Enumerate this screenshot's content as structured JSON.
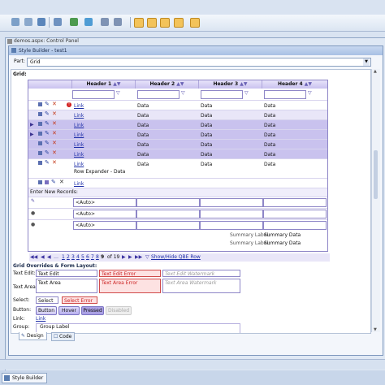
{
  "control_panel": {
    "title": "demos.aspx: Control Panel"
  },
  "style_builder": {
    "title": "Style Builder - test1"
  },
  "part": {
    "label": "Part:",
    "value": "Grid"
  },
  "grid": {
    "section_label": "Grid:",
    "headers": [
      "Header 1",
      "Header 2",
      "Header 3",
      "Header 4"
    ],
    "rows": [
      {
        "link": "Link",
        "c2": "Data",
        "c3": "Data",
        "c4": "Data"
      },
      {
        "link": "Link",
        "c2": "Data",
        "c3": "Data",
        "c4": "Data"
      },
      {
        "link": "Link",
        "c2": "Data",
        "c3": "Data",
        "c4": "Data"
      },
      {
        "link": "Link",
        "c2": "Data",
        "c3": "Data",
        "c4": "Data"
      },
      {
        "link": "Link",
        "c2": "Data",
        "c3": "Data",
        "c4": "Data"
      },
      {
        "link": "Link",
        "c2": "Data",
        "c3": "Data",
        "c4": "Data"
      },
      {
        "link": "Link",
        "c2": "Data",
        "c3": "Data",
        "c4": "Data"
      }
    ],
    "expander": "Row Expander - Data",
    "last_link": "Link",
    "enter_new": "Enter New Records:",
    "auto": "<Auto>",
    "summary_label": "Summary Label:",
    "summary_data": "Summary Data",
    "pager_pages": [
      "1",
      "2",
      "3",
      "4",
      "5",
      "6",
      "7",
      "8",
      "9"
    ],
    "pager_info": "of 19",
    "pager_current": "9",
    "show_hide": "Show/Hide QBE Row"
  },
  "overrides": {
    "title": "Grid Overrides & Form Layout:",
    "text_edit_label": "Text Edit:",
    "text_edit": "Text Edit",
    "text_edit_error": "Text Edit Error",
    "text_edit_watermark": "Text Edit Watermark",
    "text_area_label": "Text Area:",
    "text_area": "Text Area",
    "text_area_error": "Text Area Error",
    "text_area_watermark": "Text Area Watermark",
    "select_label": "Select:",
    "select": "Select",
    "select_error": "Select Error",
    "button_label": "Button:",
    "btn_button": "Button",
    "btn_hover": "Hover",
    "btn_pressed": "Pressed",
    "btn_disabled": "Disabled",
    "link_label": "Link:",
    "link": "Link",
    "group_label": "Group:",
    "group_label_text": "Group Label"
  },
  "tabs": {
    "design": "Design",
    "code": "Code"
  },
  "bottom_tab": "Style Builder",
  "colors": {
    "accent": "#8e86c7",
    "selected_row": "#c9c2ee",
    "error": "#d04a4a",
    "link": "#1e2fa8"
  }
}
